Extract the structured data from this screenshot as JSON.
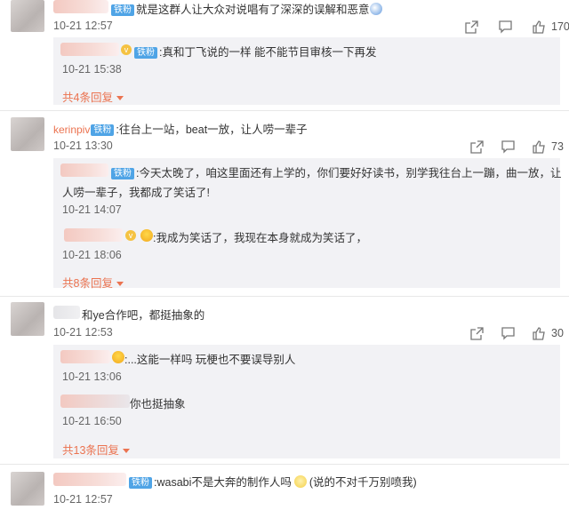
{
  "badge": "铁粉",
  "comments": [
    {
      "text": "就是这群人让大众对说唱有了深深的误解和恶意",
      "time": "10-21 12:57",
      "likes": "170",
      "replies": [
        {
          "text": ":真和丁飞说的一样 能不能节目审核一下再发",
          "time": "10-21 15:38"
        }
      ],
      "more": "共4条回复"
    },
    {
      "username": "kerinpiv",
      "text": ":往台上一站，beat一放，让人唠一辈子",
      "time": "10-21 13:30",
      "likes": "73",
      "replies": [
        {
          "line1": ":今天太晚了，咱这里面还有上学的，你们要好好读书，别学我往台上一蹦，曲一放，让",
          "line2": "人唠一辈子，我都成了笑话了!",
          "time": "10-21 14:07"
        },
        {
          "text": ":我成为笑话了，我现在本身就成为笑话了，",
          "time": "10-21 18:06"
        }
      ],
      "more": "共8条回复"
    },
    {
      "text": "和ye合作吧，都挺抽象的",
      "time": "10-21 12:53",
      "likes": "30",
      "replies": [
        {
          "text": ":...这能一样吗 玩梗也不要误导别人",
          "time": "10-21 13:06"
        },
        {
          "text": "你也挺抽象",
          "time": "10-21 16:50"
        }
      ],
      "more": "共13条回复"
    },
    {
      "text": ":wasabi不是大奔的制作人吗",
      "text2": "(说的不对千万别喷我)",
      "time": "10-21 12:57"
    }
  ],
  "icons": {
    "share": "share-icon",
    "comment": "comment-icon",
    "like": "like-icon"
  },
  "colors": {
    "username": "#eb7350",
    "badge": "#4fa4e6",
    "reply_bg": "#f2f2f5"
  }
}
